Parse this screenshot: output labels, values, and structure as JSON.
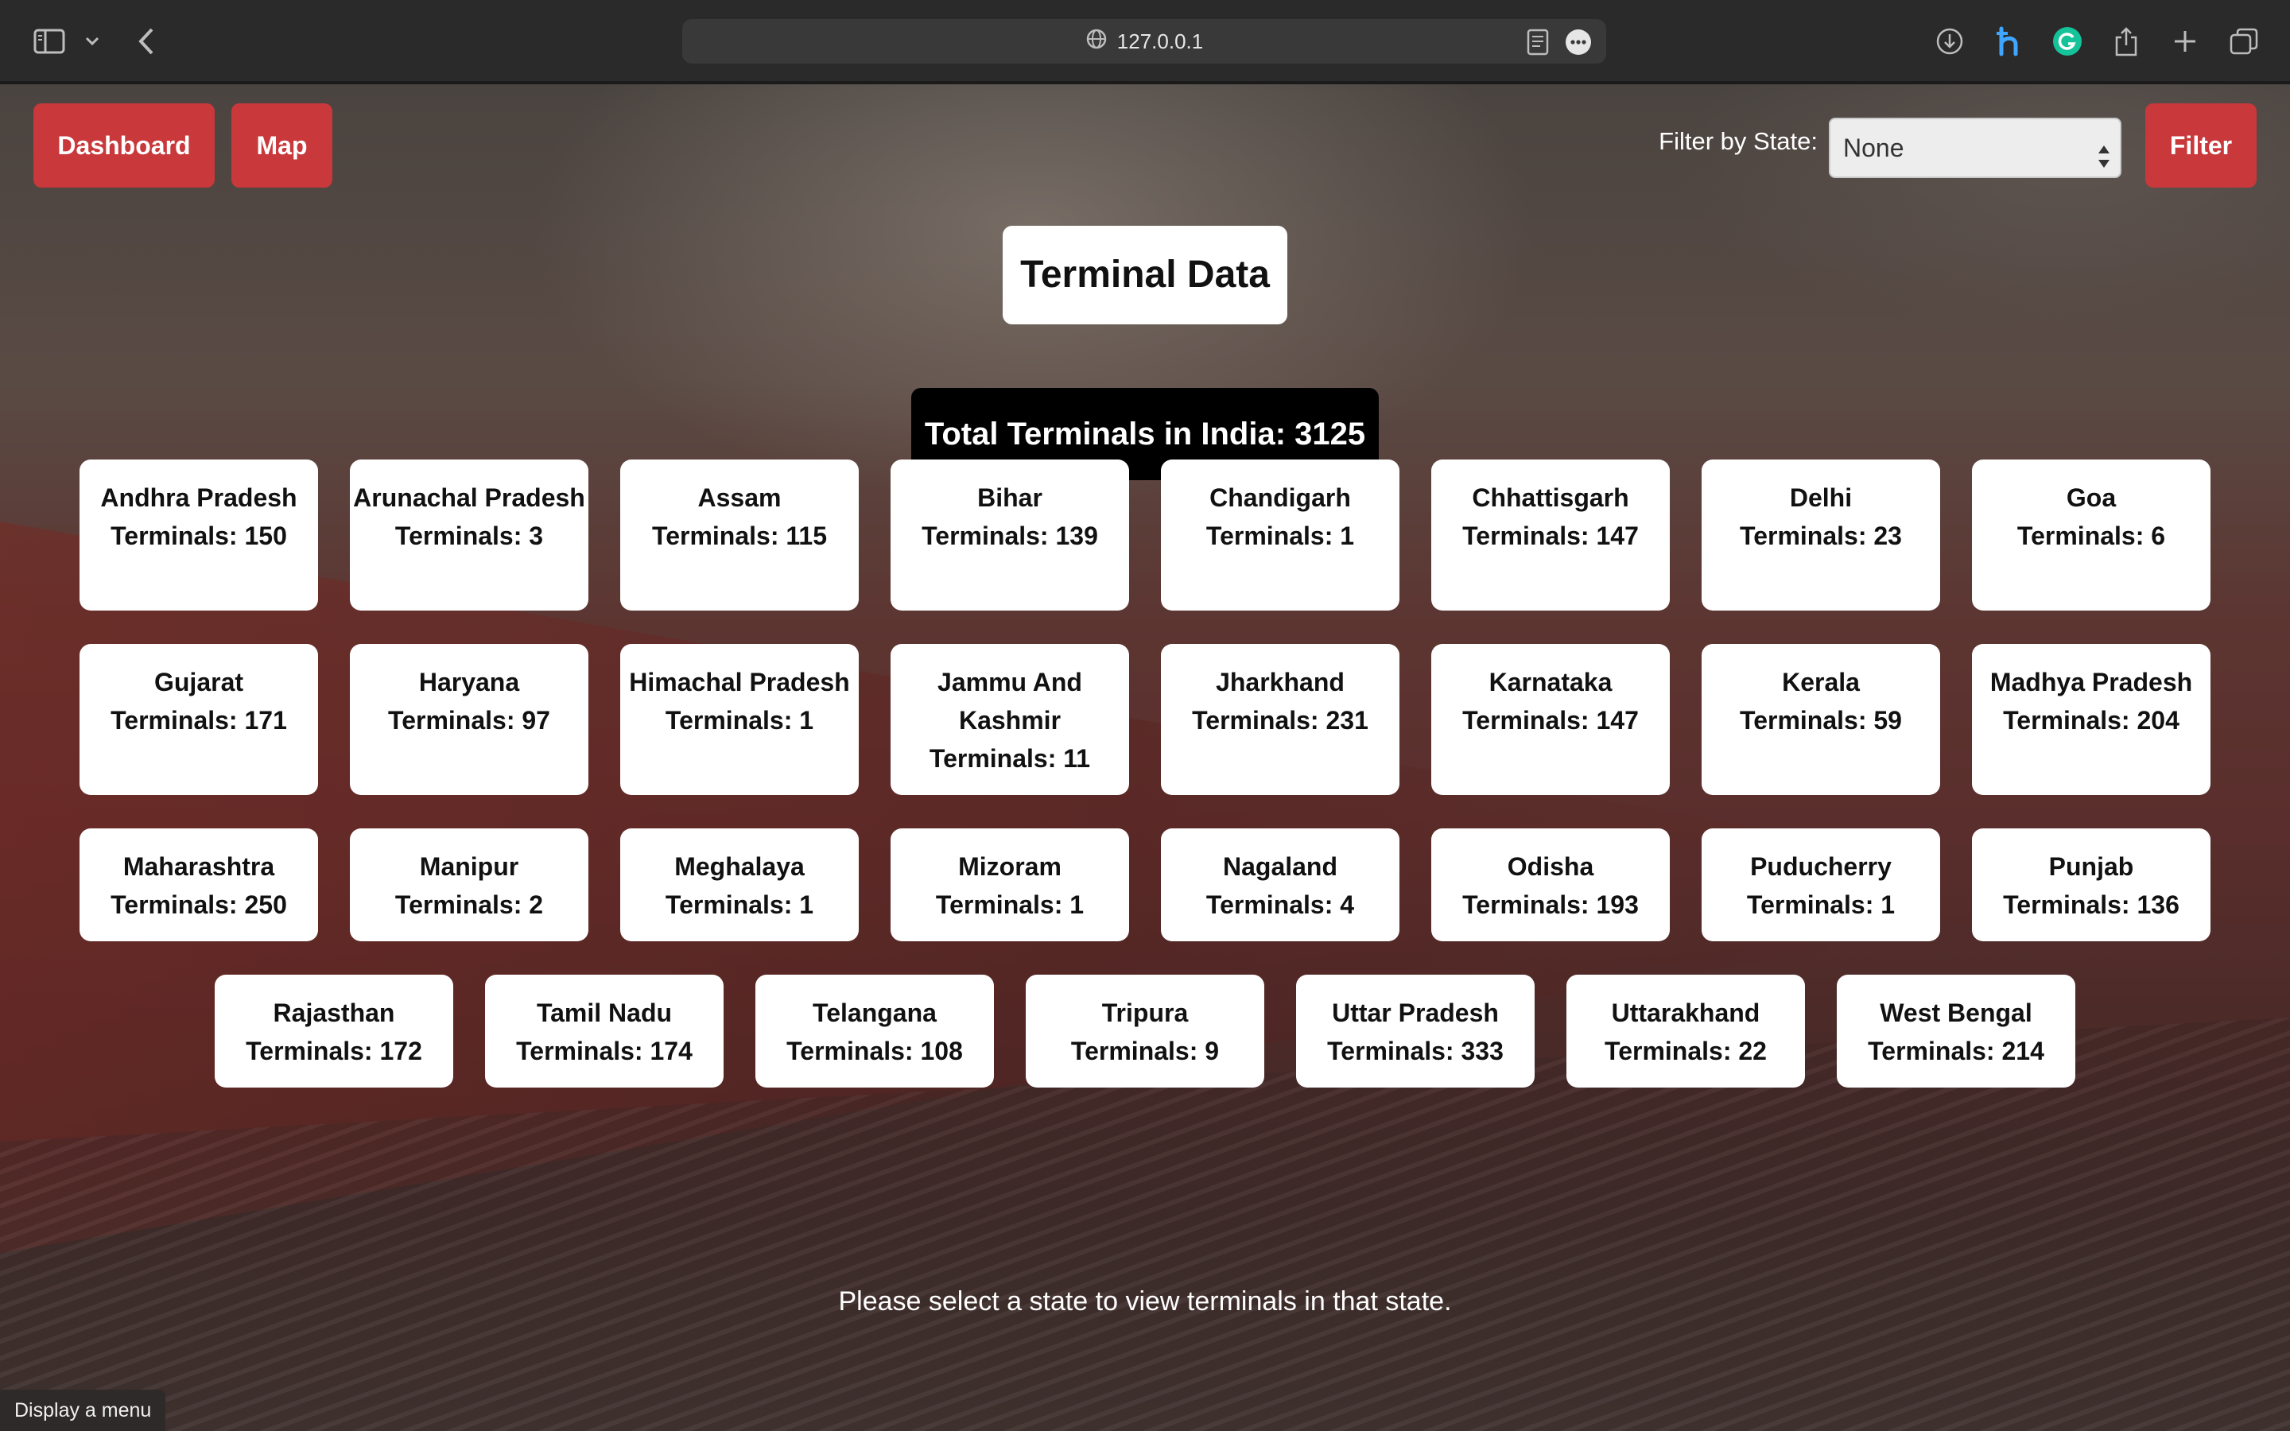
{
  "browser": {
    "url": "127.0.0.1"
  },
  "nav": {
    "dashboard_label": "Dashboard",
    "map_label": "Map"
  },
  "filter": {
    "label": "Filter by State:",
    "selected": "None",
    "button_label": "Filter"
  },
  "title": "Terminal Data",
  "total": "Total Terminals in India: 3125",
  "states": [
    {
      "name": "Andhra Pradesh",
      "terminals": "Terminals: 150"
    },
    {
      "name": "Arunachal Pradesh",
      "terminals": "Terminals: 3"
    },
    {
      "name": "Assam",
      "terminals": "Terminals: 115"
    },
    {
      "name": "Bihar",
      "terminals": "Terminals: 139"
    },
    {
      "name": "Chandigarh",
      "terminals": "Terminals: 1"
    },
    {
      "name": "Chhattisgarh",
      "terminals": "Terminals: 147"
    },
    {
      "name": "Delhi",
      "terminals": "Terminals: 23"
    },
    {
      "name": "Goa",
      "terminals": "Terminals: 6"
    },
    {
      "name": "Gujarat",
      "terminals": "Terminals: 171"
    },
    {
      "name": "Haryana",
      "terminals": "Terminals: 97"
    },
    {
      "name": "Himachal Pradesh",
      "terminals": "Terminals: 1"
    },
    {
      "name": "Jammu And Kashmir",
      "terminals": "Terminals: 11"
    },
    {
      "name": "Jharkhand",
      "terminals": "Terminals: 231"
    },
    {
      "name": "Karnataka",
      "terminals": "Terminals: 147"
    },
    {
      "name": "Kerala",
      "terminals": "Terminals: 59"
    },
    {
      "name": "Madhya Pradesh",
      "terminals": "Terminals: 204"
    },
    {
      "name": "Maharashtra",
      "terminals": "Terminals: 250"
    },
    {
      "name": "Manipur",
      "terminals": "Terminals: 2"
    },
    {
      "name": "Meghalaya",
      "terminals": "Terminals: 1"
    },
    {
      "name": "Mizoram",
      "terminals": "Terminals: 1"
    },
    {
      "name": "Nagaland",
      "terminals": "Terminals: 4"
    },
    {
      "name": "Odisha",
      "terminals": "Terminals: 193"
    },
    {
      "name": "Puducherry",
      "terminals": "Terminals: 1"
    },
    {
      "name": "Punjab",
      "terminals": "Terminals: 136"
    },
    {
      "name": "Rajasthan",
      "terminals": "Terminals: 172"
    },
    {
      "name": "Tamil Nadu",
      "terminals": "Terminals: 174"
    },
    {
      "name": "Telangana",
      "terminals": "Terminals: 108"
    },
    {
      "name": "Tripura",
      "terminals": "Terminals: 9"
    },
    {
      "name": "Uttar Pradesh",
      "terminals": "Terminals: 333"
    },
    {
      "name": "Uttarakhand",
      "terminals": "Terminals: 22"
    },
    {
      "name": "West Bengal",
      "terminals": "Terminals: 214"
    }
  ],
  "hint": "Please select a state to view terminals in that state.",
  "status_bar": "Display a menu",
  "colors": {
    "accent_red": "#c9383a",
    "card_bg": "#ffffff",
    "total_bg": "#000000"
  }
}
